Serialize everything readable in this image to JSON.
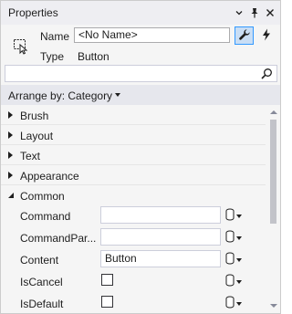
{
  "window": {
    "title": "Properties",
    "buttons": {
      "dropdown": "chevron-down-icon",
      "pin": "pin-icon",
      "close": "close-icon"
    }
  },
  "header": {
    "name_label": "Name",
    "name_value": "<No Name>",
    "type_label": "Type",
    "type_value": "Button",
    "properties_button": "wrench-icon",
    "events_button": "lightning-icon"
  },
  "search": {
    "value": "",
    "icon": "search-icon"
  },
  "arrange": {
    "label": "Arrange by: Category"
  },
  "categories": [
    {
      "label": "Brush",
      "expanded": false
    },
    {
      "label": "Layout",
      "expanded": false
    },
    {
      "label": "Text",
      "expanded": false
    },
    {
      "label": "Appearance",
      "expanded": false
    },
    {
      "label": "Common",
      "expanded": true
    }
  ],
  "properties": [
    {
      "name": "Command",
      "kind": "text",
      "value": ""
    },
    {
      "name": "CommandPar...",
      "kind": "text",
      "value": ""
    },
    {
      "name": "Content",
      "kind": "text",
      "value": "Button"
    },
    {
      "name": "IsCancel",
      "kind": "checkbox",
      "checked": false
    },
    {
      "name": "IsDefault",
      "kind": "checkbox",
      "checked": false
    }
  ],
  "colors": {
    "accent": "#3399ff",
    "toolwindow_bg": "#f5f5f5",
    "title_bg": "#eeeef2"
  }
}
